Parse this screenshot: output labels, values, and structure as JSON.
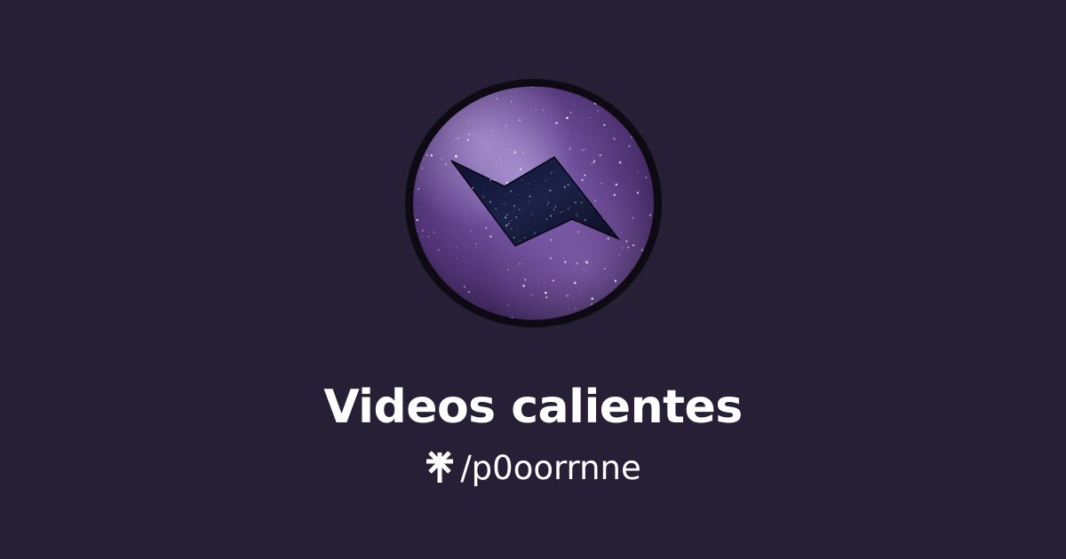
{
  "profile": {
    "title": "Videos calientes",
    "handle": "/p0oorrnne",
    "logo_icon": "linktree-asterisk-icon",
    "avatar_icon": "galaxy-bolt-avatar"
  },
  "colors": {
    "background": "#261f35",
    "text": "#ffffff",
    "avatar_base": "#4a2f6e",
    "avatar_accent": "#8a6cb8",
    "bolt": "#141428"
  }
}
